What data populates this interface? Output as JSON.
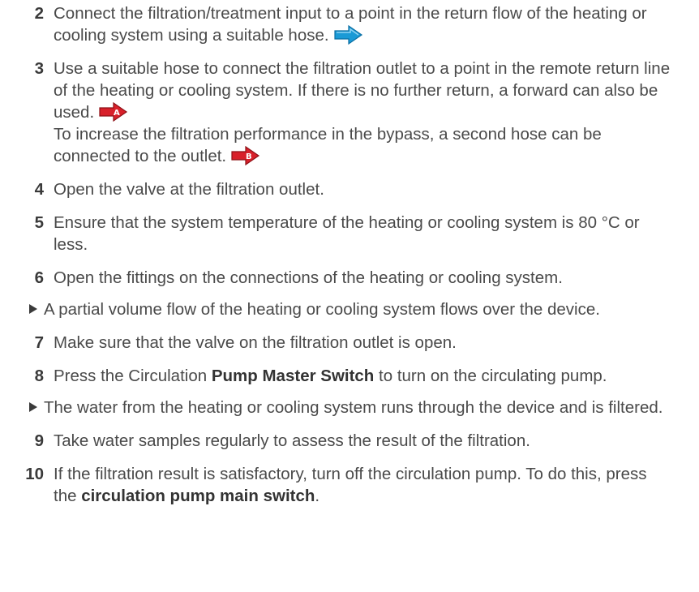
{
  "steps": [
    {
      "number": "2",
      "text": "Connect the filtration/treatment input to a point in the return flow of the heating or cooling system using a suitable hose.",
      "arrow": {
        "icon": "arrow-right-blue-icon",
        "color": "#1a9ad6",
        "letter": ""
      }
    },
    {
      "number": "3",
      "text": "Use a suitable hose to connect the filtration outlet to a point in the remote return line of the heating or cooling system. If there is no further return, a forward can also be used.",
      "arrow": {
        "icon": "arrow-right-red-a-icon",
        "color": "#d8202a",
        "letter": "A"
      },
      "text2": "To increase the filtration performance in the bypass, a second hose can be connected to the outlet.",
      "arrow2": {
        "icon": "arrow-right-red-b-icon",
        "color": "#d8202a",
        "letter": "B"
      }
    },
    {
      "number": "4",
      "text": "Open the valve at the filtration outlet."
    },
    {
      "number": "5",
      "text": "Ensure that the system temperature of the heating or cooling system is 80 °C or less."
    },
    {
      "number": "6",
      "text": "Open the fittings on the connections of the heating or cooling system."
    },
    {
      "number": "7",
      "text": "Make sure that the valve on the filtration outlet is open."
    },
    {
      "number": "8",
      "text_before": "Press the Circulation ",
      "text_bold": "Pump Master Switch",
      "text_after": " to turn on the circulating pump."
    },
    {
      "number": "9",
      "text": "Take water samples regularly to assess the result of the filtration."
    },
    {
      "number": "10",
      "text_before": "If the filtration result is satisfactory, turn off the circulation pump. To do this, press the ",
      "text_bold": "circulation pump main switch",
      "text_after": "."
    }
  ],
  "results": {
    "after_6": "A partial volume flow of the heating or cooling system flows over the device.",
    "after_8": "The water from the heating or cooling system runs through the device and is filtered."
  }
}
